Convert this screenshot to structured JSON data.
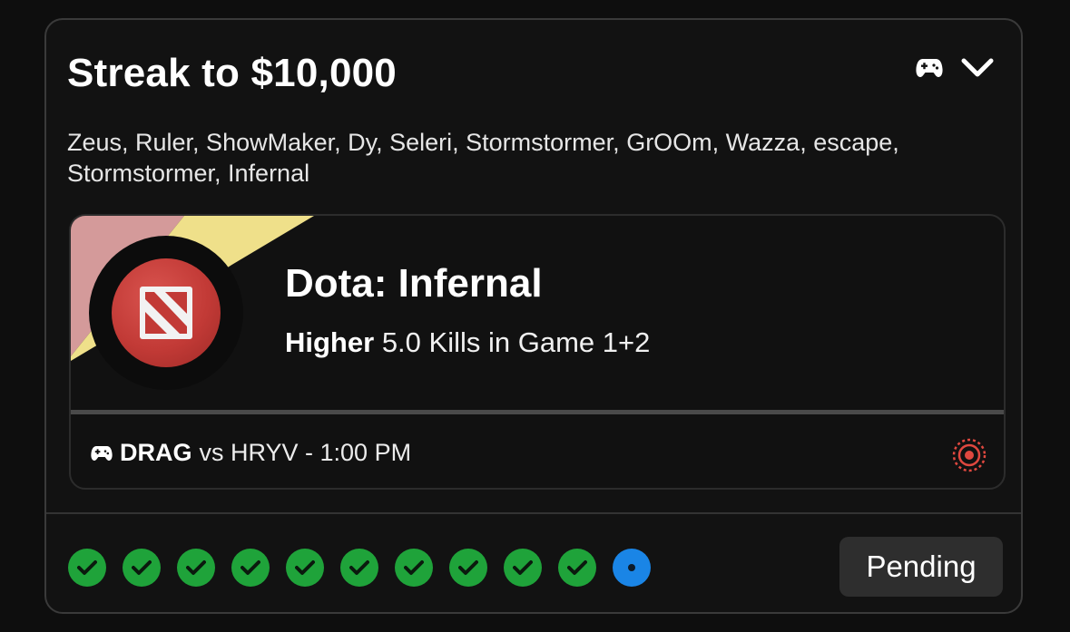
{
  "card": {
    "title": "Streak to $10,000",
    "players": "Zeus, Ruler, ShowMaker, Dy, Seleri, Stormstormer, GrOOm, Wazza, escape, Stormstormer, Infernal",
    "header_icons": [
      "gamepad-icon",
      "chevron-down-icon"
    ]
  },
  "pick": {
    "title": "Dota: Infernal",
    "direction": "Higher",
    "line": "5.0 Kills in Game 1+2",
    "team": "DRAG",
    "opponent": "vs HRYV - 1:00 PM",
    "logo": "dota-logo",
    "status_icon": "target-icon"
  },
  "streak": {
    "results": [
      "win",
      "win",
      "win",
      "win",
      "win",
      "win",
      "win",
      "win",
      "win",
      "win",
      "pending"
    ],
    "status_label": "Pending"
  },
  "colors": {
    "win": "#1fa33a",
    "pending": "#1a85e6",
    "logo_red": "#c23a36",
    "stripe_pink": "#d49a9a",
    "stripe_yellow": "#efe08a",
    "target_red": "#e0483f"
  }
}
